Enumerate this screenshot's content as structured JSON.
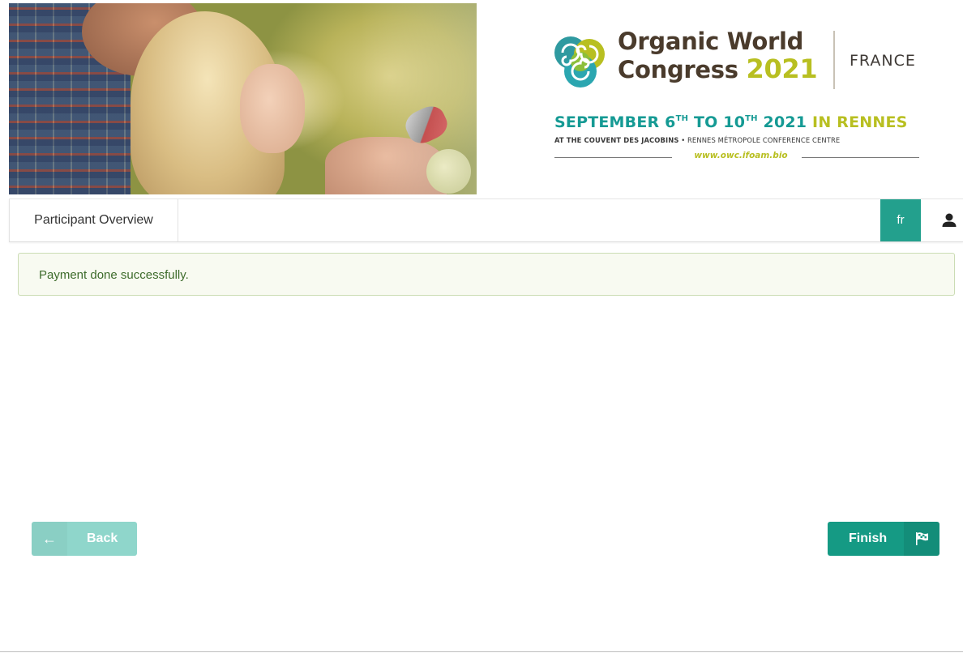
{
  "banner": {
    "logo": {
      "title_line1": "Organic World",
      "title_line2_word": "Congress",
      "title_line2_year": "2021",
      "country": "FRANCE",
      "dates_part1": "SEPTEMBER 6",
      "dates_sup1": "TH",
      "dates_part2": " TO 10",
      "dates_sup2": "TH",
      "dates_part3": " 2021 ",
      "dates_city": "IN RENNES",
      "venue_bold": "AT THE COUVENT DES JACOBINS",
      "venue_rest": " • RENNES MÉTROPOLE CONFERENCE CENTRE",
      "url": "www.owc.ifoam.bio"
    },
    "colors": {
      "brown": "#4a3b2c",
      "teal": "#159a94",
      "lime": "#b8bf21"
    }
  },
  "navbar": {
    "nav_item": "Participant Overview",
    "lang_label": "fr",
    "user_icon": "user-icon",
    "accent": "#23a08d"
  },
  "alert": {
    "message": "Payment done successfully."
  },
  "actions": {
    "back_label": "Back",
    "back_icon": "arrow-left-icon",
    "finish_label": "Finish",
    "finish_icon": "flag-checkered-icon",
    "finish_color": "#159a84",
    "back_color": "#8fd6cb"
  }
}
